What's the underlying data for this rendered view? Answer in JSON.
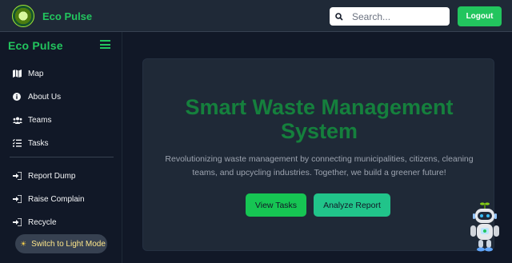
{
  "header": {
    "brand": "Eco Pulse",
    "search_placeholder": "Search...",
    "logout_label": "Logout"
  },
  "sidebar": {
    "brand": "Eco Pulse",
    "items": [
      {
        "label": "Map",
        "icon": "map-icon"
      },
      {
        "label": "About Us",
        "icon": "info-icon"
      },
      {
        "label": "Teams",
        "icon": "users-icon"
      },
      {
        "label": "Tasks",
        "icon": "tasks-icon"
      },
      {
        "label": "Report Dump",
        "icon": "sign-in-icon"
      },
      {
        "label": "Raise Complain",
        "icon": "sign-in-icon"
      },
      {
        "label": "Recycle",
        "icon": "sign-in-icon"
      }
    ],
    "mode_toggle_label": "Switch to Light Mode"
  },
  "hero": {
    "title_line1": "Smart Waste Management",
    "title_line2": "System",
    "description_line1": "Revolutionizing waste management by connecting municipalities, citizens, cleaning",
    "description_line2": "teams, and upcycling industries. Together, we build a greener future!",
    "view_tasks_label": "View Tasks",
    "analyze_report_label": "Analyze Report"
  },
  "colors": {
    "accent": "#22c55e",
    "title_green": "#15803d",
    "background": "#111827",
    "card": "#1f2937"
  }
}
